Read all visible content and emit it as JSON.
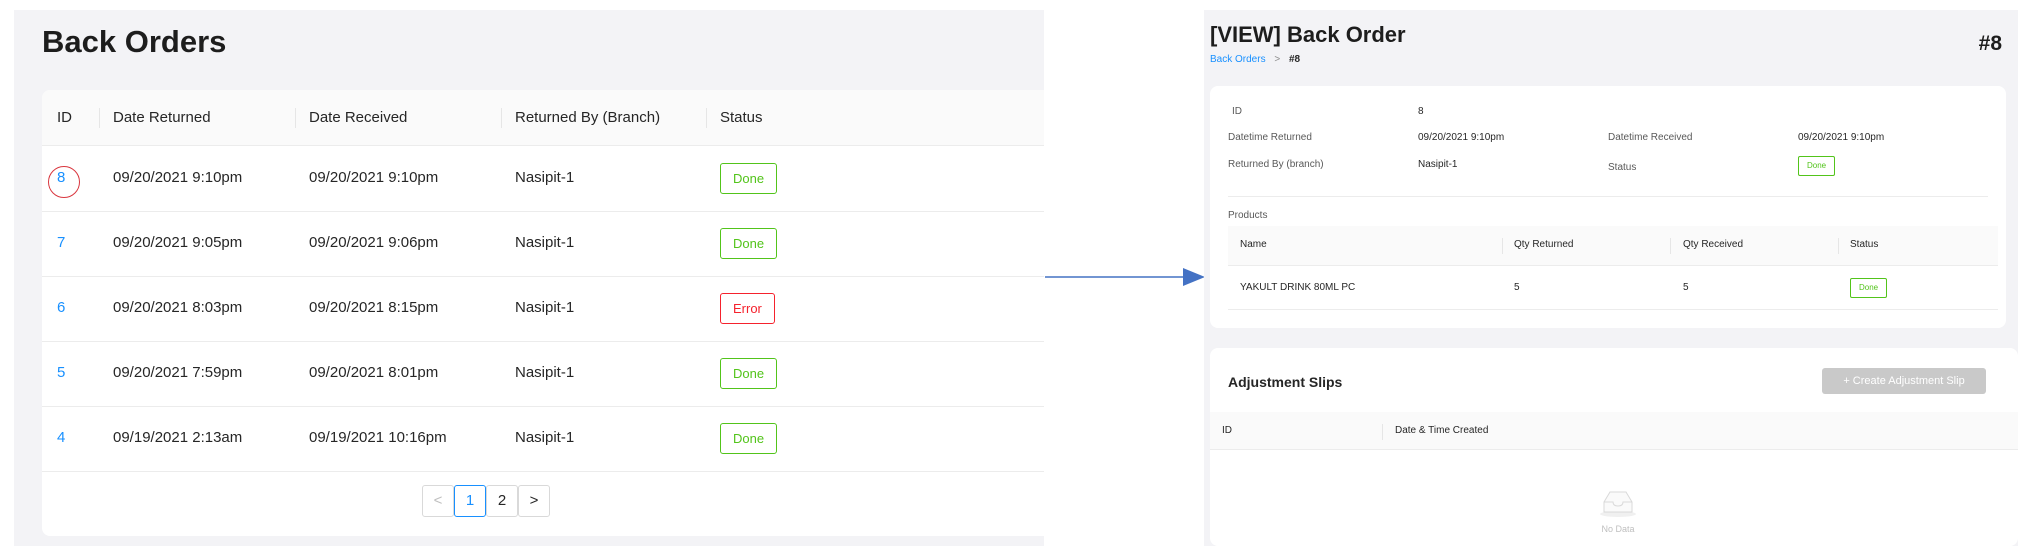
{
  "list_page": {
    "title": "Back Orders",
    "columns": [
      "ID",
      "Date Returned",
      "Date Received",
      "Returned By (Branch)",
      "Status"
    ],
    "rows": [
      {
        "id": "8",
        "date_returned": "09/20/2021 9:10pm",
        "date_received": "09/20/2021 9:10pm",
        "branch": "Nasipit-1",
        "status": "Done"
      },
      {
        "id": "7",
        "date_returned": "09/20/2021 9:05pm",
        "date_received": "09/20/2021 9:06pm",
        "branch": "Nasipit-1",
        "status": "Done"
      },
      {
        "id": "6",
        "date_returned": "09/20/2021 8:03pm",
        "date_received": "09/20/2021 8:15pm",
        "branch": "Nasipit-1",
        "status": "Error"
      },
      {
        "id": "5",
        "date_returned": "09/20/2021 7:59pm",
        "date_received": "09/20/2021 8:01pm",
        "branch": "Nasipit-1",
        "status": "Done"
      },
      {
        "id": "4",
        "date_returned": "09/19/2021 2:13am",
        "date_received": "09/19/2021 10:16pm",
        "branch": "Nasipit-1",
        "status": "Done"
      }
    ],
    "pagination": {
      "prev": "<",
      "pages": [
        "1",
        "2"
      ],
      "active": "1",
      "next": ">"
    }
  },
  "detail_page": {
    "title": "[VIEW] Back Order",
    "number": "#8",
    "breadcrumb": {
      "parent": "Back Orders",
      "separator": ">",
      "current": "#8"
    },
    "fields": {
      "id_label": "ID",
      "id_value": "8",
      "datetime_returned_label": "Datetime Returned",
      "datetime_returned_value": "09/20/2021 9:10pm",
      "datetime_received_label": "Datetime Received",
      "datetime_received_value": "09/20/2021 9:10pm",
      "returned_by_label": "Returned By (branch)",
      "returned_by_value": "Nasipit-1",
      "status_label": "Status",
      "status_value": "Done"
    },
    "products": {
      "section_label": "Products",
      "columns": [
        "Name",
        "Qty Returned",
        "Qty Received",
        "Status"
      ],
      "rows": [
        {
          "name": "YAKULT DRINK 80ML PC",
          "qty_returned": "5",
          "qty_received": "5",
          "status": "Done"
        }
      ]
    },
    "adjustment_slips": {
      "title": "Adjustment Slips",
      "create_button": "+ Create Adjustment Slip",
      "columns": [
        "ID",
        "Date & Time Created"
      ],
      "empty_text": "No Data"
    }
  },
  "colors": {
    "link": "#1890ff",
    "done": "#52c41a",
    "error": "#f5222d",
    "arrow": "#4472c4",
    "highlight_circle": "#d9363e"
  }
}
